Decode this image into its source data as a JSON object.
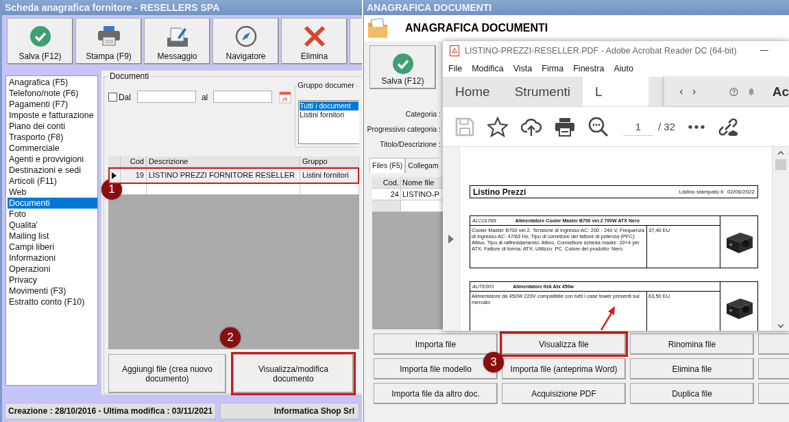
{
  "left_window": {
    "title": "Scheda anagrafica fornitore - RESELLERS SPA",
    "toolbar": [
      {
        "label": "Salva (F12)",
        "kind": "check"
      },
      {
        "label": "Stampa (F9)",
        "kind": "printer"
      },
      {
        "label": "Messaggio",
        "kind": "message"
      },
      {
        "label": "Navigatore",
        "kind": "compass"
      },
      {
        "label": "Elimina",
        "kind": "cross"
      }
    ],
    "nav": [
      {
        "label": "Anagrafica (F5)",
        "selected": false
      },
      {
        "label": "Telefono/note (F6)",
        "selected": false
      },
      {
        "label": "Pagamenti (F7)",
        "selected": false
      },
      {
        "label": "Imposte e fatturazione",
        "selected": false
      },
      {
        "label": "Piano dei conti",
        "selected": false
      },
      {
        "label": "Trasporto (F8)",
        "selected": false
      },
      {
        "label": "Commerciale",
        "selected": false
      },
      {
        "label": "Agenti e provvigioni",
        "selected": false
      },
      {
        "label": "Destinazioni e sedi",
        "selected": false
      },
      {
        "label": "Articoli (F11)",
        "selected": false
      },
      {
        "label": "Web",
        "selected": false
      },
      {
        "label": "Documenti",
        "selected": true
      },
      {
        "label": "Foto",
        "selected": false
      },
      {
        "label": "Qualita'",
        "selected": false
      },
      {
        "label": "Mailing list",
        "selected": false
      },
      {
        "label": "Campi liberi",
        "selected": false
      },
      {
        "label": "Informazioni",
        "selected": false
      },
      {
        "label": "Operazioni",
        "selected": false
      },
      {
        "label": "Privacy",
        "selected": false
      },
      {
        "label": "Movimenti (F3)",
        "selected": false
      },
      {
        "label": "Estratto conto (F10)",
        "selected": false
      }
    ],
    "documents": {
      "legend": "Documenti",
      "date_from": {
        "label": "Dal",
        "checked": false
      },
      "date_to_label": "al",
      "group": {
        "legend": "Gruppo documer",
        "items": [
          {
            "label": "Tutti i document",
            "selected": true
          },
          {
            "label": "Listini fornitori",
            "selected": false
          }
        ]
      },
      "table": {
        "columns": [
          "Cod",
          "Descrizione",
          "Gruppo"
        ],
        "rows": [
          {
            "cells": [
              "19",
              "LISTINO PREZZI FORNITORE RESELLER",
              "Listini fornitori"
            ],
            "current": true,
            "highlighted": true
          }
        ]
      },
      "buttons": [
        {
          "label": "Aggiungi file (crea nuovo documento)",
          "highlighted": false
        },
        {
          "label": "Visualizza/modifica documento",
          "highlighted": true
        }
      ]
    },
    "status_bar": {
      "left": "Creazione : 28/10/2016 - Ultima modifica : 03/11/2021",
      "right": "Informatica Shop Srl"
    }
  },
  "right_window": {
    "title": "ANAGRAFICA DOCUMENTI",
    "heading": "ANAGRAFICA DOCUMENTI",
    "toolbar": [
      {
        "label": "Salva (F12)",
        "kind": "check"
      }
    ],
    "field_labels": [
      "Categoria :",
      "Progressivo categoria :",
      "Titolo/Descrizione :"
    ],
    "tabs": [
      {
        "label": "Files (F5)",
        "selected": true
      },
      {
        "label": "Collegam",
        "selected": false
      }
    ],
    "files_table": {
      "columns": [
        "Cod.",
        "Nome file"
      ],
      "rows": [
        {
          "cells": [
            "24",
            "LISTINO-P"
          ]
        }
      ]
    },
    "buttons": [
      [
        {
          "label": "Importa file",
          "highlighted": false
        },
        {
          "label": "Visualizza file",
          "highlighted": true
        },
        {
          "label": "Rinomina file",
          "highlighted": false
        }
      ],
      [
        {
          "label": "Importa file modello",
          "highlighted": false
        },
        {
          "label": "Importa file (anteprima Word)",
          "highlighted": false
        },
        {
          "label": "Elimina file",
          "highlighted": false
        }
      ],
      [
        {
          "label": "Importa file da altro doc.",
          "highlighted": false
        },
        {
          "label": "Acquisizione PDF",
          "highlighted": false
        },
        {
          "label": "Duplica file",
          "highlighted": false
        }
      ]
    ]
  },
  "acrobat": {
    "title": "LISTINO-PREZZI-RESELLER.PDF - Adobe Acrobat Reader DC (64-bit)",
    "menu": [
      "File",
      "Modifica",
      "Vista",
      "Firma",
      "Finestra",
      "Aiuto"
    ],
    "tabs": [
      {
        "label": "Home",
        "selected": false
      },
      {
        "label": "Strumenti",
        "selected": false
      },
      {
        "label": "L",
        "selected": true
      }
    ],
    "account_label": "Ac",
    "tools": [
      {
        "kind": "save",
        "disabled": true
      },
      {
        "kind": "star",
        "disabled": false
      },
      {
        "kind": "upload",
        "disabled": false
      },
      {
        "kind": "printer",
        "disabled": false
      },
      {
        "kind": "zoom",
        "disabled": false
      }
    ],
    "page": {
      "current": "1",
      "total": "/ 32"
    },
    "document": {
      "title": "Listino Prezzi",
      "printed_label": "Listino stampato il:",
      "printed_date": "02/06/2022",
      "items": [
        {
          "code": "ALCOL099",
          "name": "Alimentatore Cooler Master B700 ver.2 700W ATX Nero",
          "description": "Cooler Master B700 ver.2. Tensione di ingresso AC: 200 - 240 V, Frequenza di ingresso AC: 47/63 Hz, Tipo di correttore del fattore di potenza (PFC): Attivo. Tipo di raffreddamento: Attivo. Connettore scheda madre: 20+4 pin ATX. Fattore di forma: ATX. Utilizzo: PC. Colore del prodotto: Nero",
          "price": "37,40 EU"
        },
        {
          "code": "ALITE003",
          "name": "Alimentatore Itek Atx 450w",
          "description": "Alimentatore da 450W 220V compatibile con tutti i case tower presenti sul mercato",
          "price": "63,50 EU"
        }
      ]
    }
  },
  "callouts": [
    {
      "number": "1"
    },
    {
      "number": "2"
    },
    {
      "number": "3"
    }
  ]
}
